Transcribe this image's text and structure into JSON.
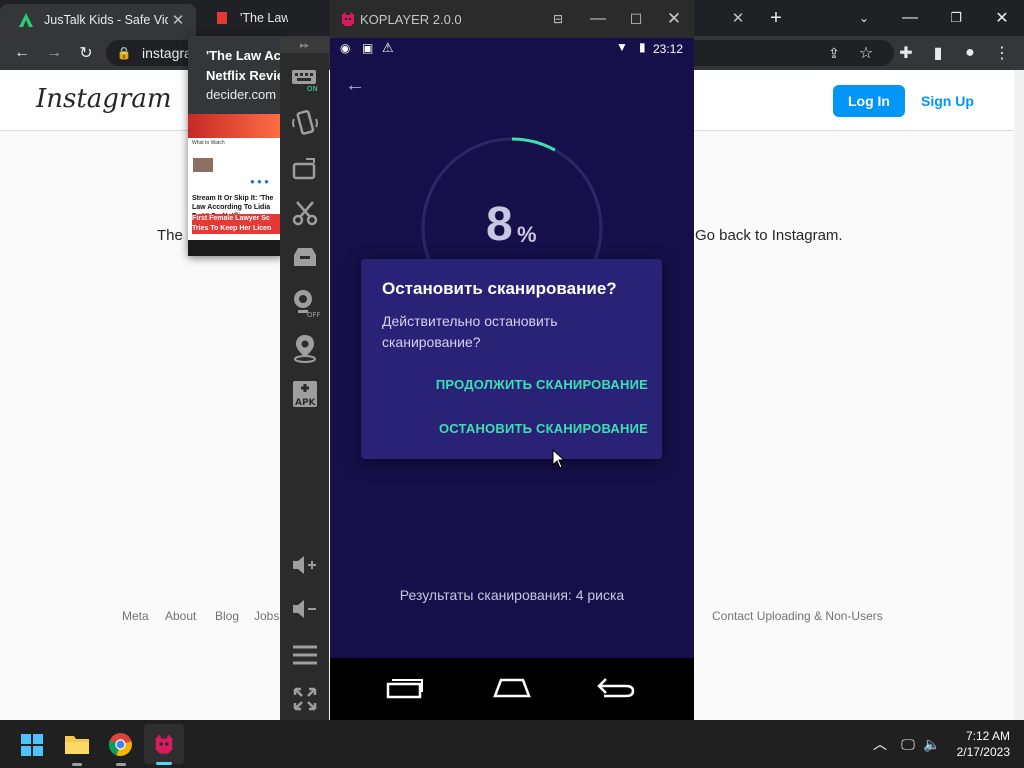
{
  "browser": {
    "tabs": [
      {
        "title": "JusTalk Kids - Safe Video"
      },
      {
        "title": "'The Law According"
      }
    ],
    "new_tab_label": "+",
    "address": "instagra",
    "tooltip": {
      "title": "'The Law According to Lidia Poët' Netflix Review",
      "title_line1": "'The Law Acc",
      "title_line2": "Netflix Revie",
      "domain": "decider.com",
      "thumb_nav": "What to Watch",
      "thumb_headline": "Stream It Or Skip It: 'The Law According To Lidia Poët' On Netflix",
      "thumb_red": "First Female Lawyer Sc Tries To Keep Her Licen"
    }
  },
  "instagram": {
    "logo": "Instagram",
    "login_label": "Log In",
    "signup_label": "Sign Up",
    "text_left": "The",
    "text_right": "Go back to Instagram.",
    "footer_left": [
      "Meta",
      "About",
      "Blog",
      "Jobs"
    ],
    "footer_right": "Contact Uploading & Non-Users"
  },
  "koplayer": {
    "title": "KOPLAYER 2.0.0",
    "sidebar_labels": {
      "keyboard_on": "ON",
      "camera_off": "OFF",
      "apk": "APK"
    },
    "status_time": "23:12",
    "progress_value": "8",
    "progress_unit": "%",
    "progress_fraction": 0.08,
    "dialog": {
      "title": "Остановить сканирование?",
      "message": "Действительно остановить сканирование?",
      "continue_label": "ПРОДОЛЖИТЬ СКАНИРОВАНИЕ",
      "stop_label": "ОСТАНОВИТЬ СКАНИРОВАНИЕ"
    },
    "results": "Результаты сканирования: 4 риска"
  },
  "taskbar": {
    "time": "7:12 AM",
    "date": "2/17/2023"
  },
  "colors": {
    "accent_teal": "#3ce0b1",
    "scan_bg": "#16104a",
    "dialog_bg": "#2a2277",
    "instagram_blue": "#0095f6"
  }
}
